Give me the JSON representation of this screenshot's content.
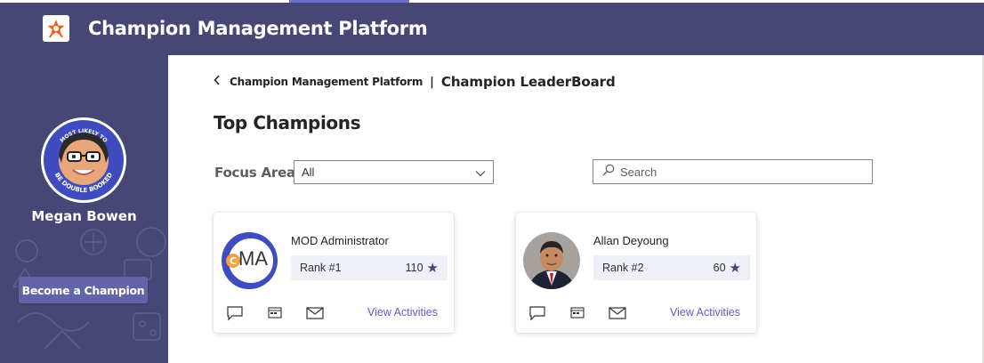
{
  "app": {
    "title": "Champion Management Platform"
  },
  "sidebar": {
    "user_name": "Megan Bowen",
    "badge_top_text": "MOST LIKELY TO",
    "badge_bottom_text": "BE DOUBLE BOOKED",
    "become_button": "Become a Champion"
  },
  "breadcrumb": {
    "back_icon": "chevron-left-icon",
    "parent": "Champion Management Platform",
    "separator": "|",
    "current": "Champion LeaderBoard"
  },
  "main": {
    "title": "Top Champions",
    "focus_area": {
      "label": "Focus Area",
      "selected": "All"
    },
    "search": {
      "placeholder": "Search"
    }
  },
  "champions": [
    {
      "name": "MOD Administrator",
      "initials": "MA",
      "rank": "Rank #1",
      "points": "110",
      "view_label": "View Activities"
    },
    {
      "name": "Allan Deyoung",
      "initials": "",
      "rank": "Rank #2",
      "points": "60",
      "view_label": "View Activities"
    }
  ],
  "colors": {
    "header_bg": "#464775",
    "accent": "#6264a7",
    "link": "#5b5fc7",
    "rank_bg": "#eef0f8"
  }
}
